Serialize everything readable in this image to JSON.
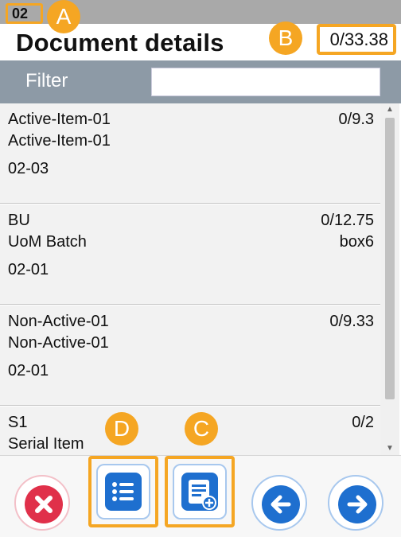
{
  "header": {
    "code": "02",
    "title": "Document details",
    "total": "0/33.38"
  },
  "callouts": {
    "a": "A",
    "b": "B",
    "c": "C",
    "d": "D"
  },
  "filter": {
    "label": "Filter",
    "value": "",
    "placeholder": ""
  },
  "items": [
    {
      "line1": "Active-Item-01",
      "line2": "Active-Item-01",
      "line3": "02-03",
      "qty": "0/9.3",
      "uom": ""
    },
    {
      "line1": "BU",
      "line2": "UoM Batch",
      "line3": "02-01",
      "qty": "0/12.75",
      "uom": "box6"
    },
    {
      "line1": "Non-Active-01",
      "line2": "Non-Active-01",
      "line3": "02-01",
      "qty": "0/9.33",
      "uom": ""
    },
    {
      "line1": "S1",
      "line2": "Serial Item",
      "line3": "",
      "qty": "0/2",
      "uom": ""
    }
  ],
  "toolbar": {
    "cancel_icon": "close-icon",
    "list_icon": "list-icon",
    "add_doc_icon": "document-add-icon",
    "back_icon": "arrow-left-icon",
    "next_icon": "arrow-right-icon"
  },
  "colors": {
    "accent": "#f5a623",
    "primary": "#1e6fcf",
    "danger": "#e0304a",
    "filter_bar": "#8d9aa6",
    "top_strip": "#a9a9a9"
  }
}
